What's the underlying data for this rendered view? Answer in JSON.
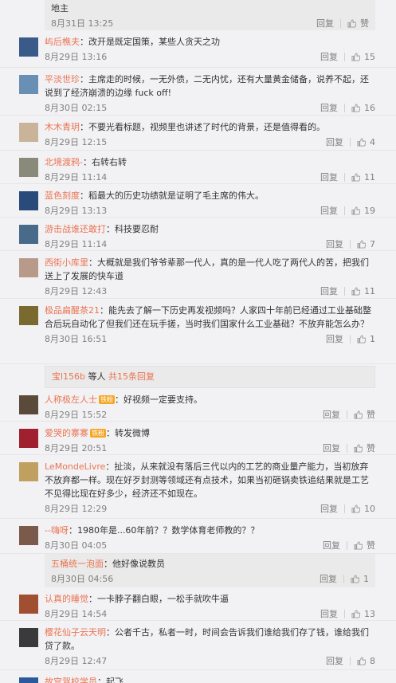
{
  "top_partial": {
    "text": "地主",
    "time": "8月31日 13:25",
    "reply": "回复",
    "like": "赞"
  },
  "comments": [
    {
      "user": "屿后樵夫",
      "text": "改开是既定国策，某些人贪天之功",
      "time": "8月29日 13:16",
      "reply": "回复",
      "like": "15"
    },
    {
      "user": "平淡世珍",
      "text": "主席走的时候，一无外债，二无内忧，还有大量黄金储备，说养不起，还说到了经济崩溃的边缘 fuck off!",
      "time": "8月30日 02:15",
      "reply": "回复",
      "like": "16"
    },
    {
      "user": "木木青玥",
      "text": "不要光看标题，视频里也讲述了时代的背景，还是值得看的。",
      "time": "8月29日 12:15",
      "reply": "回复",
      "like": "4"
    },
    {
      "user": "北境渡鸦-",
      "text": "右转右转",
      "time": "8月29日 11:14",
      "reply": "回复",
      "like": "11"
    },
    {
      "user": "蓝色刻度",
      "text": "稻最大的历史功绩就是证明了毛主席的伟大。",
      "time": "8月29日 13:13",
      "reply": "回复",
      "like": "19"
    },
    {
      "user": "游击战谁还敢打",
      "text": "科技要忍耐",
      "time": "8月29日 11:14",
      "reply": "回复",
      "like": "7"
    },
    {
      "user": "西街小库里",
      "text": "大概就是我们爷爷辈那一代人，真的是一代人吃了两代人的苦，把我们送上了发展的快车道",
      "time": "8月29日 12:43",
      "reply": "回复",
      "like": "11"
    },
    {
      "user": "极品扁醒茶21",
      "text": "能先去了解一下历史再发视频吗？人家四十年前已经通过工业基础整合后玩自动化了但我们还在玩手搓，当时我们国家什么工业基础？不放弃能怎么办？",
      "time": "8月30日 16:51",
      "reply": "回复",
      "like": "1"
    }
  ],
  "more_replies": {
    "user": "宝l156b",
    "mid": " 等人 ",
    "count": "共15条回复"
  },
  "comments2": [
    {
      "user": "人称极左人士",
      "badge": "铁粉",
      "text": "好视频一定要支持。",
      "time": "8月29日 15:52",
      "reply": "回复",
      "like": "赞"
    },
    {
      "user": "爱哭的寨寨",
      "badge": "铁粉",
      "text": "转发微博",
      "time": "8月29日 20:51",
      "reply": "回复",
      "like": "赞"
    },
    {
      "user": "LeMondeLivre",
      "text": "扯淡，从来就没有落后三代以内的工艺的商业量产能力，当初放弃不放弃都一样。现在好歹封测等领域还有点技术，如果当初砸锅卖铁追结果就是工艺不见得比现在好多少，经济还不如现在。",
      "time": "8月29日 12:29",
      "reply": "回复",
      "like": "10"
    },
    {
      "user": "--嗨呀",
      "text": "1980年是...60年前？？数学体育老师教的？？",
      "time": "8月30日 04:05",
      "reply": "回复",
      "like": "赞"
    }
  ],
  "sub_reply": {
    "user": "五桶统一泡面",
    "text": "他好像说教员",
    "time": "8月30日 04:56",
    "reply": "回复",
    "like": "1"
  },
  "comments3": [
    {
      "user": "认真的睡觉",
      "text": "一卡脖子翻白眼，一松手就吹牛逼",
      "time": "8月29日 14:54",
      "reply": "回复",
      "like": "13"
    },
    {
      "user": "樱花仙子云天明",
      "text": "公者千古，私者一时，时间会告诉我们谁给我们存了钱，谁给我们贷了款。",
      "time": "8月29日 12:47",
      "reply": "回复",
      "like": "8"
    },
    {
      "user": "故宫驾校学员",
      "text": "起飞",
      "time": "",
      "reply": "",
      "like": ""
    }
  ],
  "colors": {
    "username": "#eb7350",
    "meta": "#808080",
    "bg": "#f2f2f5"
  }
}
